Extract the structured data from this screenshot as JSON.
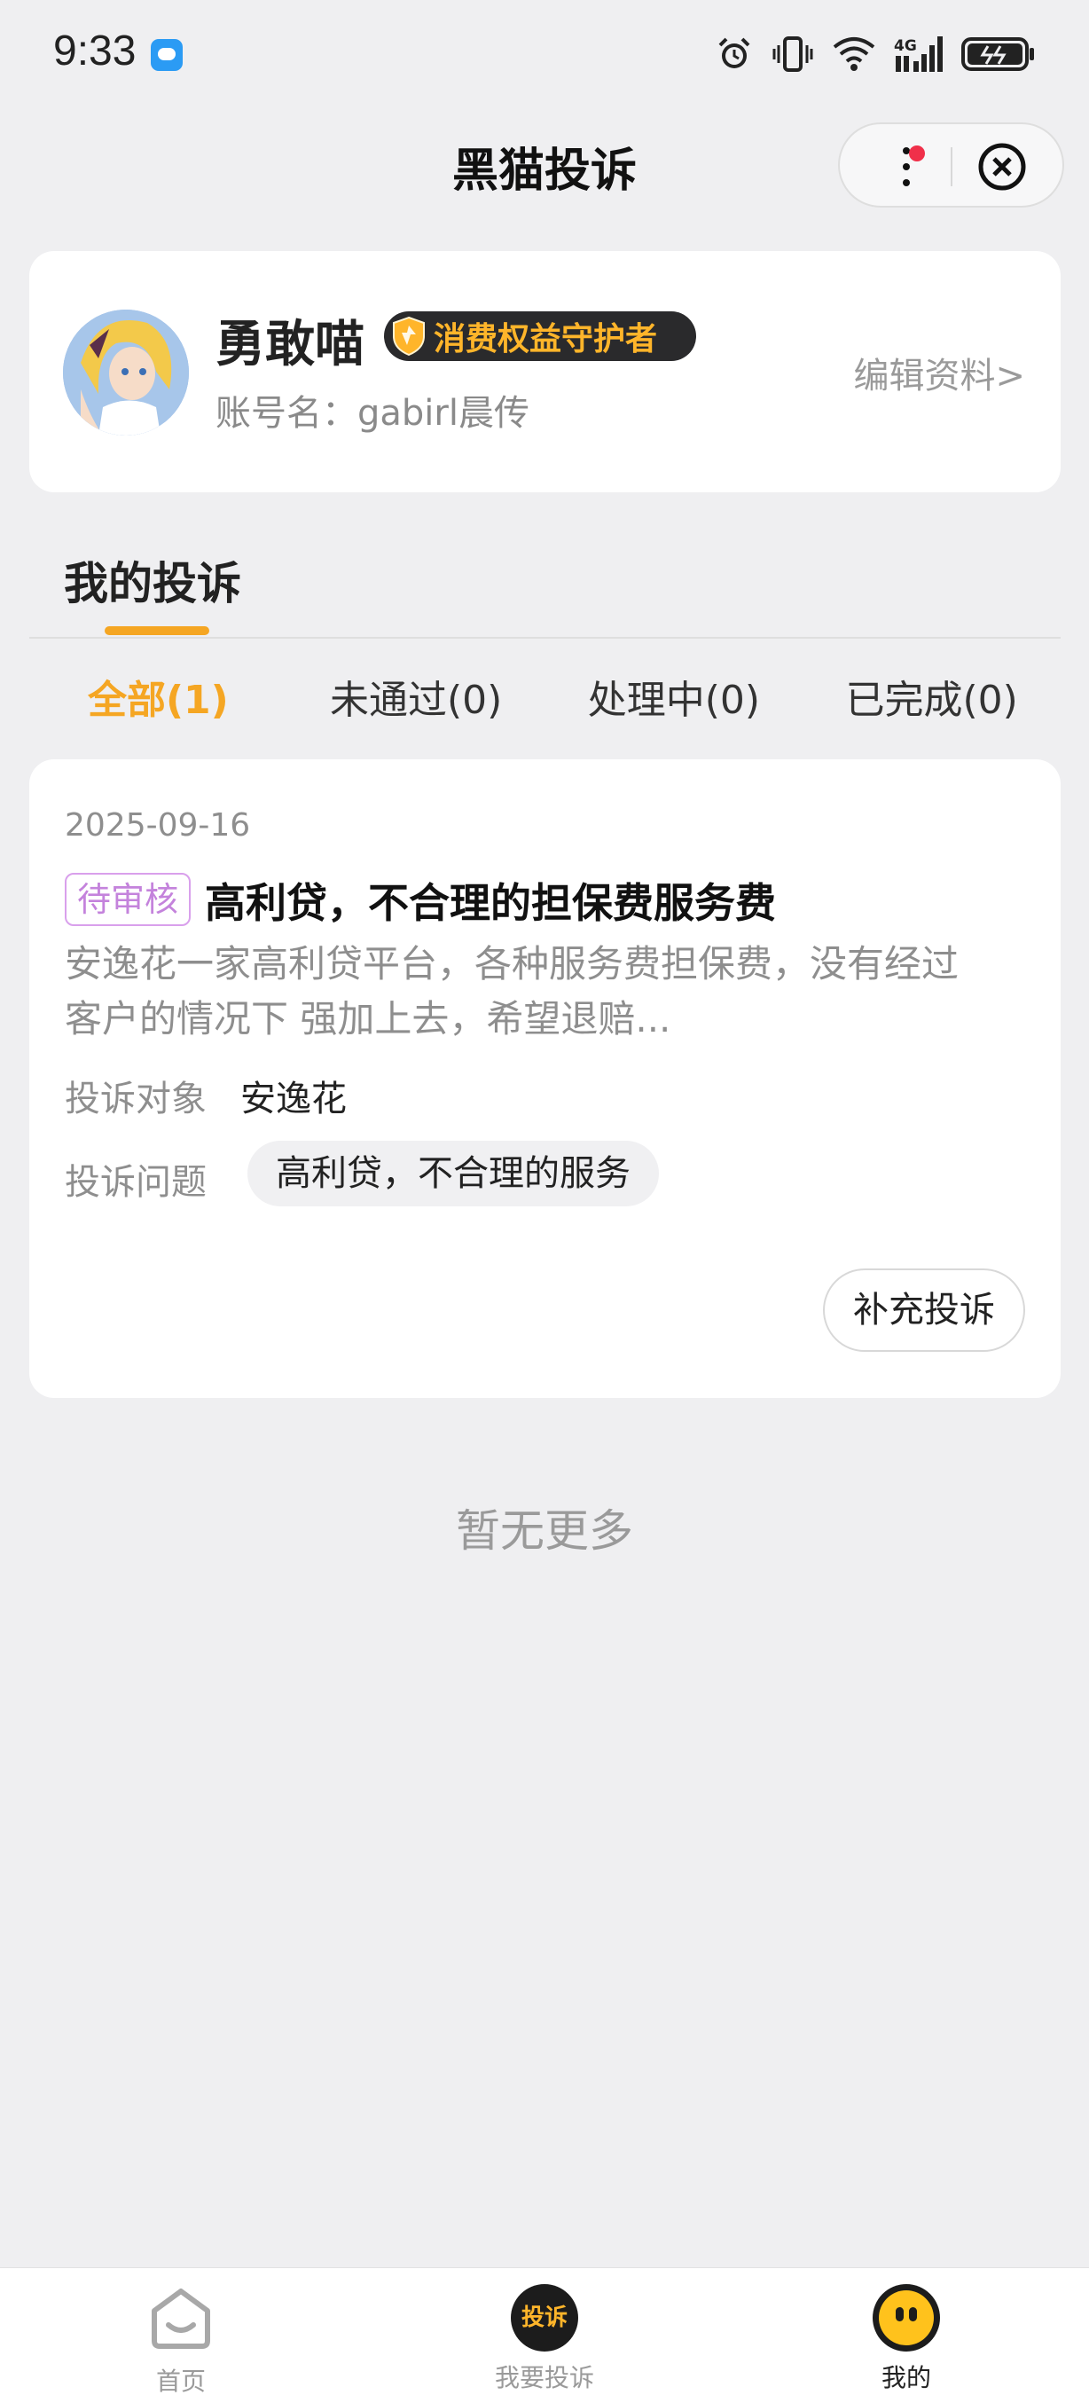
{
  "status_bar": {
    "time": "9:33",
    "icons": [
      "message-app-icon",
      "alarm-icon",
      "vibrate-icon",
      "wifi-icon",
      "4g-signal-icon",
      "battery-icon"
    ],
    "network_label": "4G"
  },
  "header": {
    "title": "黑猫投诉",
    "icons": [
      "more-icon",
      "close-circle-icon"
    ]
  },
  "profile": {
    "nickname": "勇敢喵",
    "badge": "消费权益守护者",
    "account_label": "账号名：",
    "account_value": "gabirl晨传",
    "edit_link": "编辑资料>",
    "accent_color": "#ffb52a"
  },
  "section": {
    "title": "我的投诉"
  },
  "tabs": [
    {
      "label": "全部(1)",
      "active": true
    },
    {
      "label": "未通过(0)",
      "active": false
    },
    {
      "label": "处理中(0)",
      "active": false
    },
    {
      "label": "已完成(0)",
      "active": false
    }
  ],
  "complaint": {
    "date": "2025-09-16",
    "status": "待审核",
    "title": "高利贷，不合理的担保费服务费",
    "description": "安逸花一家高利贷平台，各种服务费担保费，没有经过客户的情况下 强加上去，希望退赔...",
    "target_label": "投诉对象",
    "target_value": "安逸花",
    "issue_label": "投诉问题",
    "issue_tag": "高利贷，不合理的服务",
    "action_button": "补充投诉"
  },
  "list_footer": "暂无更多",
  "bottom_nav": [
    {
      "label": "首页",
      "icon": "home-icon",
      "active": false
    },
    {
      "label": "我要投诉",
      "icon": "complain-icon",
      "icon_text": "投诉",
      "active": false
    },
    {
      "label": "我的",
      "icon": "mine-icon",
      "active": true
    }
  ],
  "colors": {
    "accent": "#f5a623",
    "background": "#efeff1",
    "status_tag": "#c483dc"
  }
}
